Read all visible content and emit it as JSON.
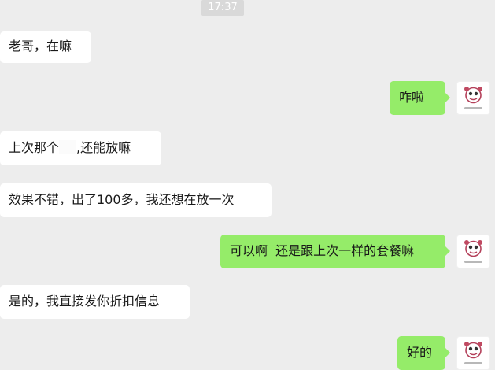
{
  "status": {
    "time": "17:37"
  },
  "messages": [
    {
      "side": "received",
      "text": "老哥，在嘛"
    },
    {
      "side": "sent",
      "text": "咋啦"
    },
    {
      "side": "received",
      "text_before": "上次那个",
      "text_after": ",还能放嘛"
    },
    {
      "side": "received",
      "text": "效果不错，出了100多，我还想在放一次"
    },
    {
      "side": "sent",
      "text": "可以啊  还是跟上次一样的套餐嘛"
    },
    {
      "side": "received",
      "text": "是的，我直接发你折扣信息"
    },
    {
      "side": "sent",
      "text": "好的"
    }
  ],
  "colors": {
    "background": "#ededed",
    "sent_bubble": "#95ec69",
    "received_bubble": "#ffffff"
  },
  "icons": {
    "avatar": "cartoon-avatar-icon"
  }
}
